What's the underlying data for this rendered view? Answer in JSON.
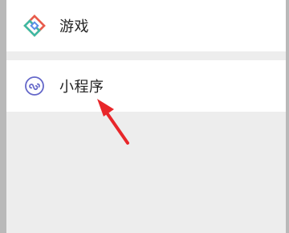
{
  "menu": {
    "items": [
      {
        "label": "游戏",
        "icon": "games-diamond-icon"
      },
      {
        "label": "小程序",
        "icon": "mini-program-icon"
      }
    ]
  },
  "colors": {
    "row_background": "#ffffff",
    "page_background": "#ededed",
    "mini_program_icon": "#6467c9",
    "annotation_arrow": "#e8262a"
  }
}
